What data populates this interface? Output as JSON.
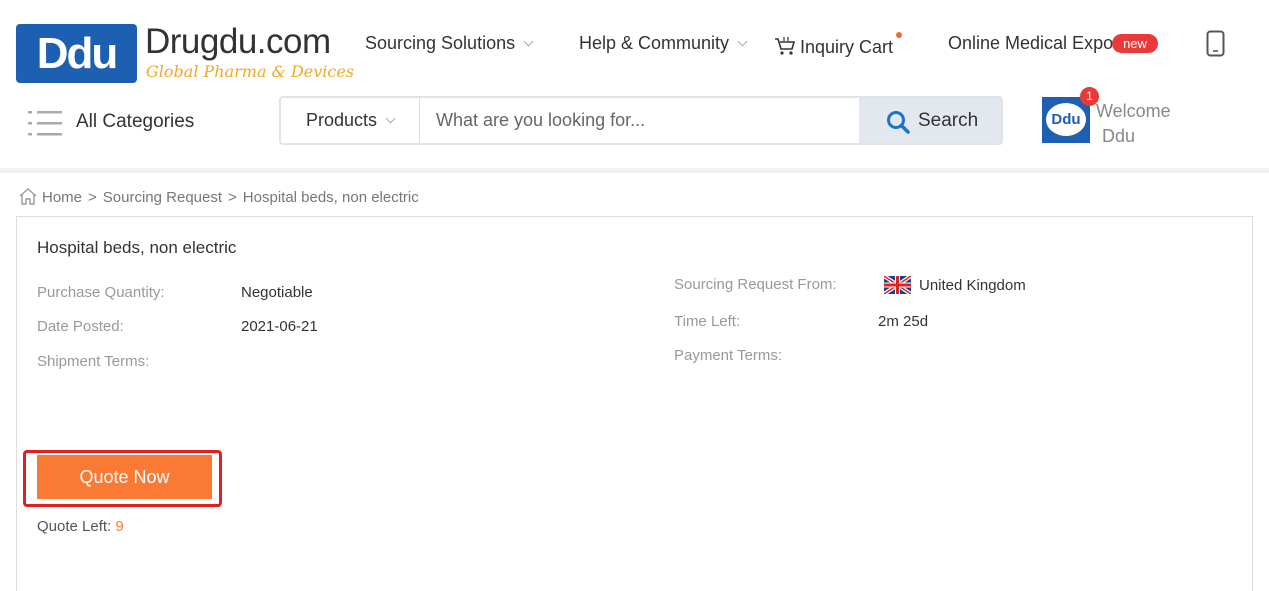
{
  "logo": {
    "mark": "Ddu",
    "name": "Drugdu.com",
    "tagline": "Global Pharma & Devices"
  },
  "nav": {
    "sourcing": "Sourcing Solutions",
    "help": "Help & Community",
    "cart": "Inquiry Cart",
    "expo": "Online Medical Expo",
    "expo_badge": "new"
  },
  "categories_label": "All Categories",
  "search": {
    "type": "Products",
    "placeholder": "What are you looking for...",
    "button": "Search"
  },
  "user": {
    "avatar_text": "Ddu",
    "notifications": "1",
    "welcome": "Welcome",
    "name": "Ddu"
  },
  "breadcrumb": {
    "home": "Home",
    "separator": ">",
    "section": "Sourcing Request",
    "current": "Hospital beds, non electric"
  },
  "request": {
    "title": "Hospital beds, non electric",
    "purchase_quantity_label": "Purchase Quantity:",
    "purchase_quantity": "Negotiable",
    "date_posted_label": "Date Posted:",
    "date_posted": "2021-06-21",
    "shipment_terms_label": "Shipment Terms:",
    "from_label": "Sourcing Request From:",
    "from_country": "United Kingdom",
    "time_left_label": "Time Left:",
    "time_left": "2m 25d",
    "payment_terms_label": "Payment Terms:",
    "quote_button": "Quote Now",
    "quote_left_label": "Quote Left:",
    "quote_left": "9"
  },
  "colors": {
    "brand_blue": "#1d5fb0",
    "accent_orange": "#fa7a35",
    "badge_red": "#e8393b",
    "highlight_red": "#e02020"
  }
}
